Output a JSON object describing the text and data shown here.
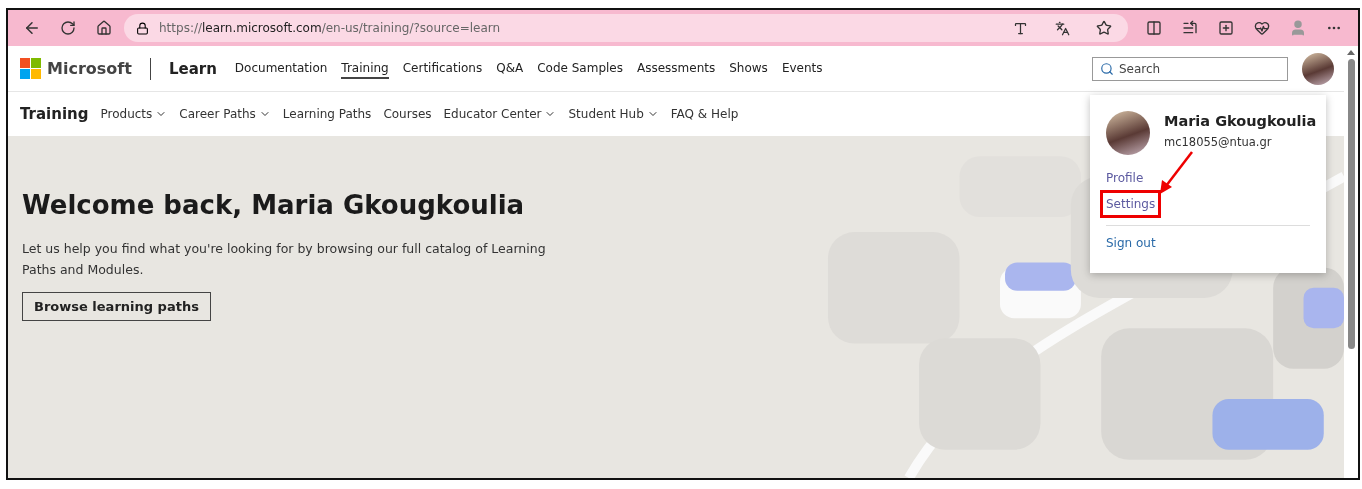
{
  "browser": {
    "url": "https://**learn.microsoft.com**/en-us/training/?source=learn"
  },
  "header": {
    "brand": "Microsoft",
    "product": "Learn",
    "search": {
      "placeholder": "Search"
    },
    "nav": [
      {
        "label": "Documentation",
        "selected": false
      },
      {
        "label": "Training",
        "selected": true
      },
      {
        "label": "Certifications",
        "selected": false
      },
      {
        "label": "Q&A",
        "selected": false
      },
      {
        "label": "Code Samples",
        "selected": false
      },
      {
        "label": "Assessments",
        "selected": false
      },
      {
        "label": "Shows",
        "selected": false
      },
      {
        "label": "Events",
        "selected": false
      }
    ]
  },
  "subnav": {
    "title": "Training",
    "items": [
      {
        "label": "Products",
        "has_menu": true
      },
      {
        "label": "Career Paths",
        "has_menu": true
      },
      {
        "label": "Learning Paths",
        "has_menu": false
      },
      {
        "label": "Courses",
        "has_menu": false
      },
      {
        "label": "Educator Center",
        "has_menu": true
      },
      {
        "label": "Student Hub",
        "has_menu": true
      },
      {
        "label": "FAQ & Help",
        "has_menu": false
      }
    ]
  },
  "hero": {
    "title": "Welcome back, Maria Gkougkoulia",
    "text": "Let us help you find what you're looking for by browsing our full catalog of Learning Paths and Modules.",
    "button": "Browse learning paths"
  },
  "account_menu": {
    "name": "Maria Gkougkoulia",
    "email": "mc18055@ntua.gr",
    "links": [
      {
        "label": "Profile",
        "annotated": false
      },
      {
        "label": "Settings",
        "annotated": true
      }
    ],
    "sign_out": "Sign out"
  }
}
